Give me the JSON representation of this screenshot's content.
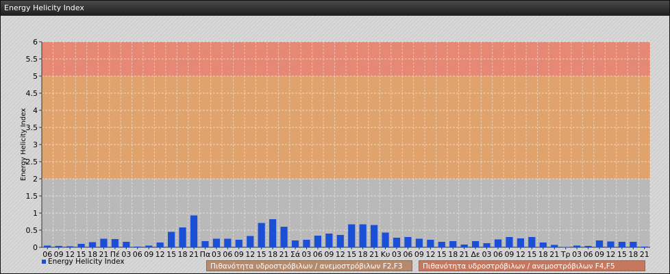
{
  "window": {
    "title": "Energy Helicity Index"
  },
  "legend": {
    "series_label": "Energy Helicity Index",
    "band_1": "Πιθανότητα υδροστρόβιλων / ανεμοστρόβιλων F2,F3",
    "band_2": "Πιθανότητα υδροστρόβιλων / ανεμοστρόβιλων F4,F5"
  },
  "colors": {
    "bar": "#1a4fd6",
    "band_low": "#b4b4b4",
    "band_mid": "#e29a5a",
    "band_high": "#e77a63",
    "band_1_legend": "#b58a6d",
    "band_2_legend": "#c8775f"
  },
  "chart_data": {
    "type": "bar",
    "ylabel": "Energy Helicity Index",
    "ylim": [
      0,
      6
    ],
    "yticks": [
      0,
      0.5,
      1,
      1.5,
      2,
      2.5,
      3,
      3.5,
      4,
      4.5,
      5,
      5.5,
      6
    ],
    "bands": [
      {
        "from": 0,
        "to": 2,
        "color": "#b4b4b4"
      },
      {
        "from": 2,
        "to": 5,
        "color": "#e29a5a"
      },
      {
        "from": 5,
        "to": 6,
        "color": "#e77a63"
      }
    ],
    "categories": [
      "06",
      "09",
      "12",
      "15",
      "18",
      "21",
      "Πέ",
      "03",
      "06",
      "09",
      "12",
      "15",
      "18",
      "21",
      "Πα",
      "03",
      "06",
      "09",
      "12",
      "15",
      "18",
      "21",
      "Σά",
      "03",
      "06",
      "09",
      "12",
      "15",
      "18",
      "21",
      "Κυ",
      "03",
      "06",
      "09",
      "12",
      "15",
      "18",
      "21",
      "Δε",
      "03",
      "06",
      "09",
      "12",
      "15",
      "18",
      "21",
      "Τρ",
      "03",
      "06",
      "09",
      "12",
      "15",
      "18",
      "21"
    ],
    "series": [
      {
        "name": "Energy Helicity Index",
        "values": [
          0.05,
          0.04,
          0.03,
          0.1,
          0.15,
          0.25,
          0.24,
          0.16,
          0.02,
          0.05,
          0.14,
          0.45,
          0.58,
          0.93,
          0.18,
          0.25,
          0.25,
          0.22,
          0.33,
          0.71,
          0.82,
          0.6,
          0.2,
          0.22,
          0.34,
          0.4,
          0.36,
          0.67,
          0.67,
          0.65,
          0.43,
          0.28,
          0.3,
          0.25,
          0.22,
          0.16,
          0.18,
          0.08,
          0.18,
          0.12,
          0.23,
          0.3,
          0.26,
          0.3,
          0.14,
          0.07,
          0.01,
          0.05,
          0.04,
          0.2,
          0.17,
          0.16,
          0.16,
          0.02
        ]
      }
    ]
  }
}
